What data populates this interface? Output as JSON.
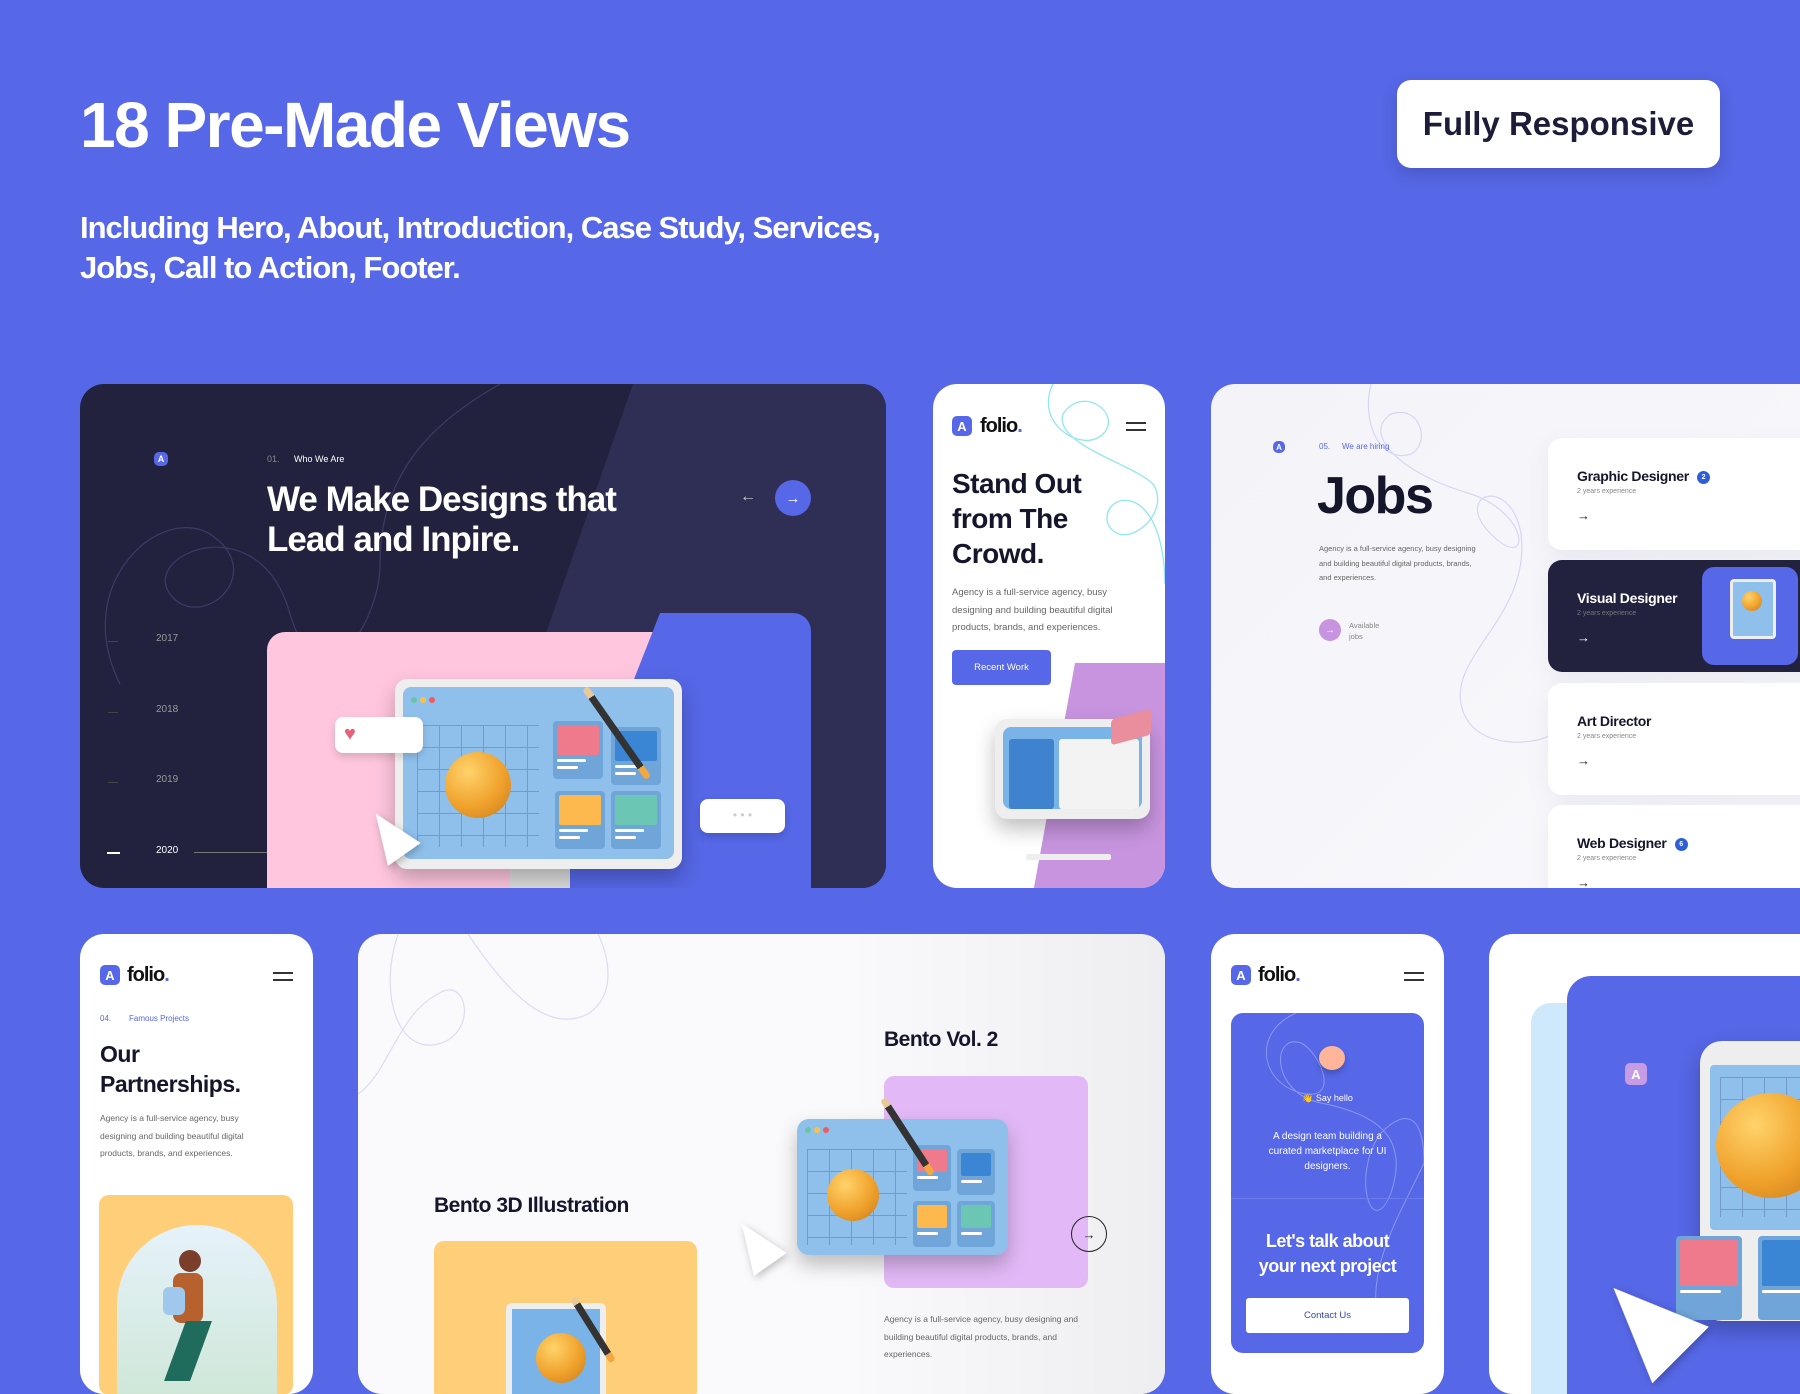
{
  "header": {
    "title": "18 Pre-Made Views",
    "subtitle": "Including Hero, About, Introduction, Case Study, Services, Jobs, Call to Action, Footer.",
    "badge_label": "Fully Responsive"
  },
  "colors": {
    "background": "#5667E7",
    "dark": "#22223F",
    "accent": "#5667E7",
    "pink": "#FFC6DE",
    "purple": "#C894E0"
  },
  "hero": {
    "logo_icon": "folio-logo-icon",
    "section_number": "01.",
    "section_label": "Who We Are",
    "heading_line1": "We Make Designs that",
    "heading_line2": "Lead and Inpire.",
    "prev_icon": "arrow-left-icon",
    "next_icon": "arrow-right-icon",
    "years": [
      "2017",
      "2018",
      "2019",
      "2020"
    ],
    "active_year": "2020"
  },
  "mobile_hero": {
    "brand": "folio",
    "brand_dot": ".",
    "heading": [
      "Stand Out",
      "from The",
      "Crowd."
    ],
    "paragraph": "Agency is a full-service agency, busy designing and building beautiful digital products, brands, and experiences.",
    "button": "Recent Work"
  },
  "jobs": {
    "section_number": "05.",
    "section_label": "We are hiring",
    "heading": "Jobs",
    "paragraph": "Agency is a full-service agency, busy designing and building beautiful digital products, brands, and experiences.",
    "available_label": "Available jobs",
    "items": [
      {
        "title": "Graphic Designer",
        "subtitle": "2 years experience",
        "badge": "2",
        "dark": false
      },
      {
        "title": "Visual Designer",
        "subtitle": "2 years experience",
        "badge": "",
        "dark": true
      },
      {
        "title": "Art Director",
        "subtitle": "2 years experience",
        "badge": "",
        "dark": false
      },
      {
        "title": "Web Designer",
        "subtitle": "2 years experience",
        "badge": "6",
        "dark": false
      }
    ],
    "arrow": "→"
  },
  "partnerships": {
    "brand": "folio",
    "brand_dot": ".",
    "section_number": "04.",
    "section_label": "Famous Projects",
    "heading_line1": "Our",
    "heading_line2": "Partnerships.",
    "paragraph": "Agency is a full-service agency, busy designing and building beautiful digital products, brands, and experiences."
  },
  "bento": {
    "item1_title": "Bento 3D Illustration",
    "item2_title": "Bento Vol. 2",
    "paragraph": "Agency is a full-service agency, busy designing and building beautiful digital products, brands, and experiences.",
    "next_icon": "arrow-right-circle-icon"
  },
  "contact": {
    "brand": "folio",
    "brand_dot": ".",
    "say_hello": "👋 Say hello",
    "description": "A design team building a curated marketplace for UI designers.",
    "cta": "Let's talk about your next project",
    "button": "Contact Us"
  }
}
